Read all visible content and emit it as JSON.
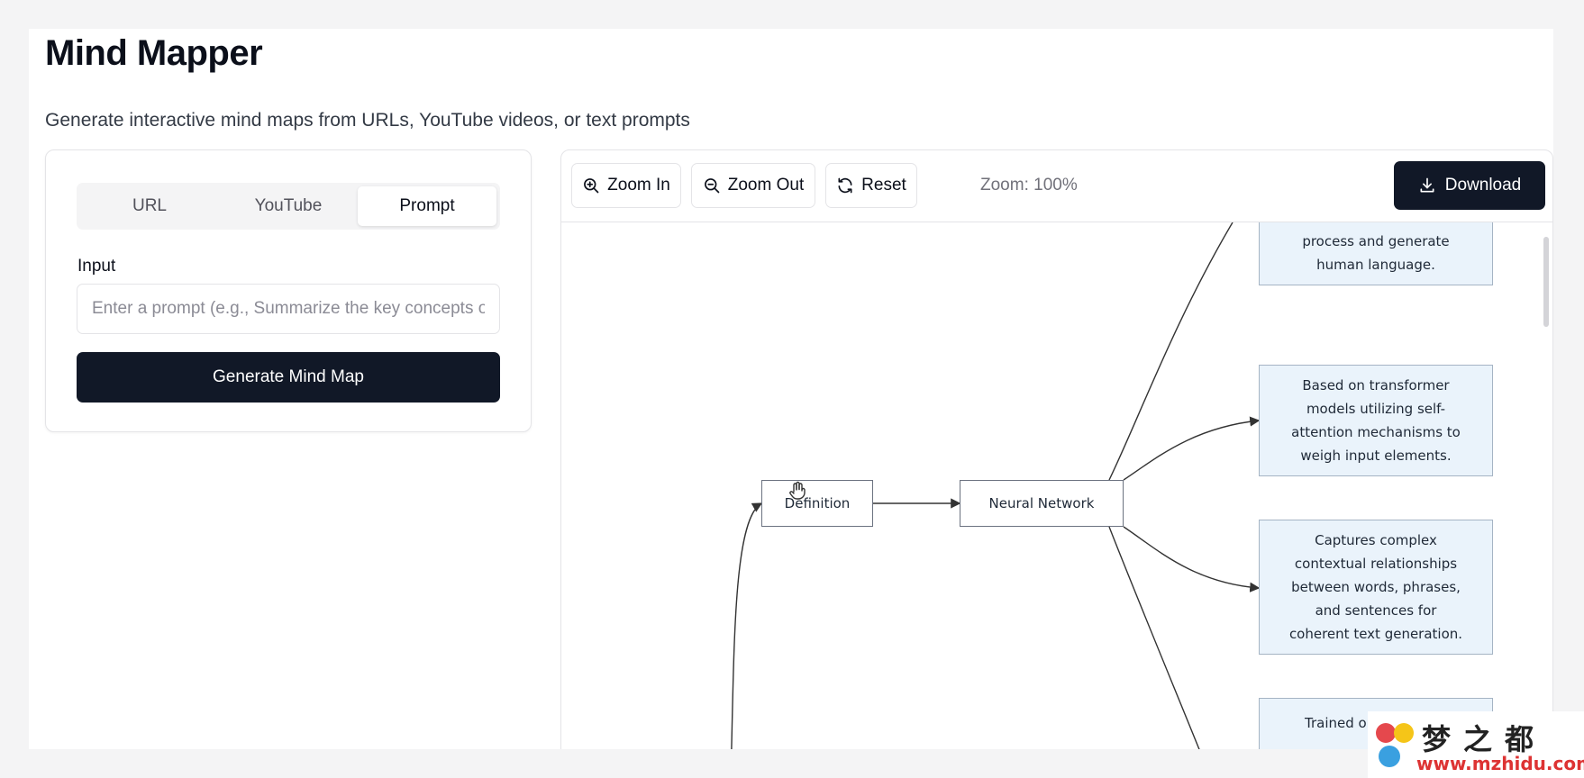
{
  "header": {
    "title": "Mind Mapper",
    "subtitle": "Generate interactive mind maps from URLs, YouTube videos, or text prompts"
  },
  "input_panel": {
    "tabs": [
      {
        "label": "URL",
        "active": false
      },
      {
        "label": "YouTube",
        "active": false
      },
      {
        "label": "Prompt",
        "active": true
      }
    ],
    "input_label": "Input",
    "input_value": "",
    "input_placeholder": "Enter a prompt (e.g., Summarize the key concepts of...)",
    "generate_label": "Generate Mind Map"
  },
  "toolbar": {
    "zoom_in_label": "Zoom In",
    "zoom_out_label": "Zoom Out",
    "reset_label": "Reset",
    "zoom_level": "Zoom: 100%",
    "download_label": "Download"
  },
  "mindmap": {
    "nodes": {
      "definition": "Definition",
      "neural_network": "Neural Network",
      "leaf1_lines": [
        "process and generate",
        "human language."
      ],
      "leaf2_lines": [
        "Based on transformer",
        "models utilizing self-",
        "attention mechanisms to",
        "weigh input elements."
      ],
      "leaf3_lines": [
        "Captures complex",
        "contextual relationships",
        "between words, phrases,",
        "and sentences for",
        "coherent text generation."
      ],
      "leaf4_lines": [
        "Trained on"
      ]
    }
  },
  "watermark": {
    "text_cn": "梦之都",
    "url": "www.mzhidu.com"
  },
  "colors": {
    "primary_dark": "#111827",
    "leaf_fill": "#eaf3fb",
    "edge": "#333333"
  }
}
